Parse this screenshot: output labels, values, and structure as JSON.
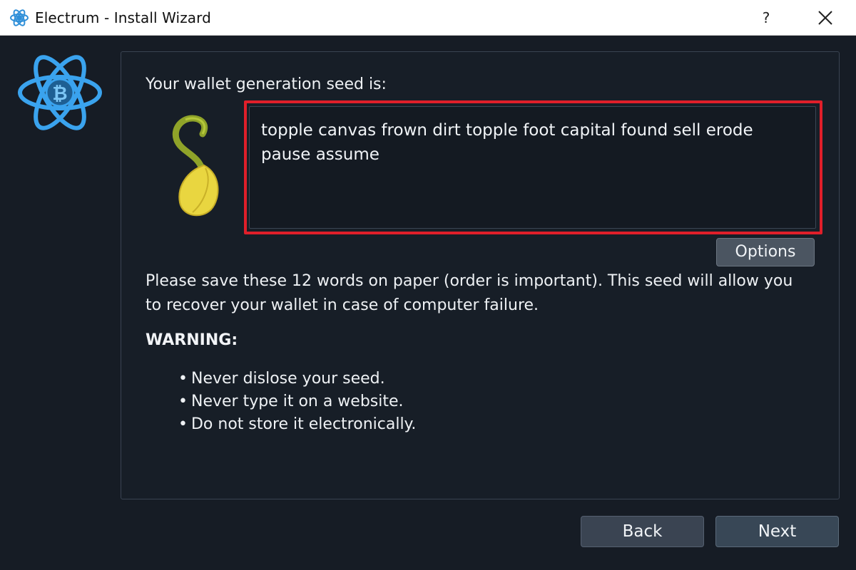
{
  "window": {
    "title": "Electrum  -  Install Wizard",
    "help_label": "?",
    "app_icon": "electrum-atom-icon",
    "close_icon": "close-icon"
  },
  "logo": {
    "icon": "electrum-bitcoin-atom-logo"
  },
  "seed": {
    "label": "Your wallet generation seed is:",
    "words": "topple canvas frown dirt topple foot capital found sell erode pause assume",
    "image_icon": "sprouting-seed-icon",
    "highlight_color": "#e01f2a"
  },
  "options_label": "Options",
  "instructions": "Please save these 12 words on paper (order is important). This seed will allow you to recover your wallet in case of computer failure.",
  "warning": {
    "title": "WARNING:",
    "items": [
      "Never dislose your seed.",
      "Never type it on a website.",
      "Do not store it electronically."
    ]
  },
  "buttons": {
    "back": "Back",
    "next": "Next"
  },
  "colors": {
    "background": "#161c25",
    "accent": "#3a9be0",
    "titlebar": "#ffffff"
  }
}
